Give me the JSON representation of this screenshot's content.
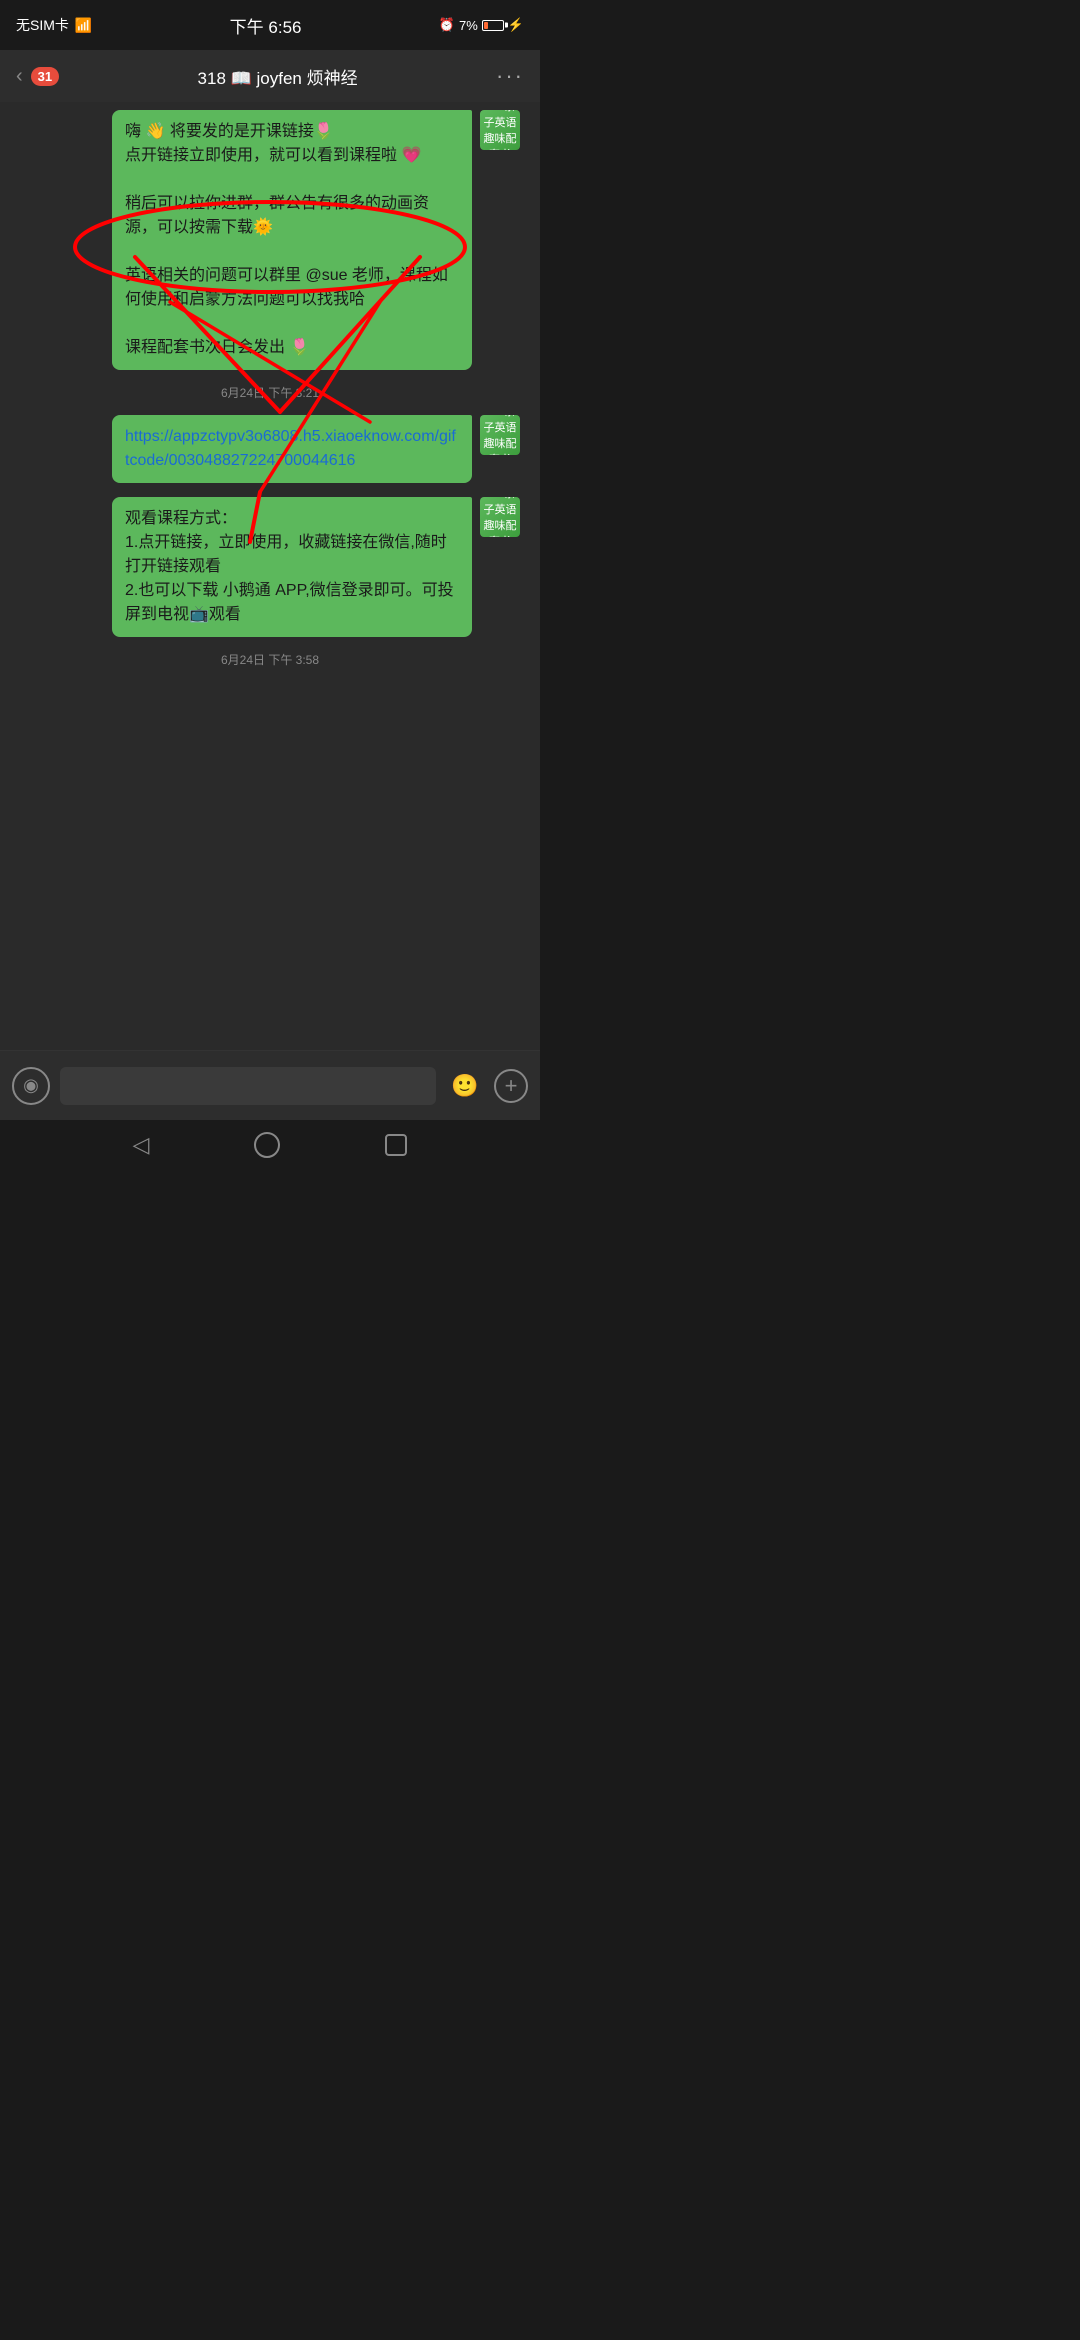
{
  "statusBar": {
    "simText": "无SIM卡",
    "wifiIcon": "wifi",
    "time": "下午 6:56",
    "alarmIcon": "alarm",
    "battery": "7%",
    "chargingIcon": "⚡"
  },
  "navBar": {
    "backLabel": "31",
    "title": "318 📖 joyfen 烦神经",
    "moreLabel": "···"
  },
  "messages": [
    {
      "id": "msg1",
      "type": "sent",
      "text": "嗨 👋 将要发的是开课链接🌷\n点开链接立即使用，就可以看到课程啦 💗\n\n稍后可以拉你进群，群公告有很多的动画资源，可以按需下载🌞\n\n英语相关的问题可以群里 @sue 老师，课程如何使用和启蒙方法问题可以找我哈\n\n课程配套书次日会发出 🌷",
      "avatarText": "Sue亲子英语\n趣味配套书"
    },
    {
      "id": "ts1",
      "type": "timestamp",
      "text": "6月24日 下午 3:21"
    },
    {
      "id": "msg2",
      "type": "sent",
      "link": "https://appzctypv3o6808.h5.xiaoeknow.com/giftcode/003048827224700044616",
      "avatarText": "Sue亲子英语\n趣味配套书"
    },
    {
      "id": "msg3",
      "type": "sent",
      "text": "观看课程方式：\n1.点开链接，立即使用，收藏链接在微信,随时打开链接观看\n2.也可以下载 小鹅通 APP,微信登录即可。可投屏到电视📺观看",
      "avatarText": "Sue亲子英语\n趣味配套书"
    },
    {
      "id": "ts2",
      "type": "timestamp",
      "text": "6月24日 下午 3:58"
    }
  ],
  "inputBar": {
    "placeholder": "",
    "voiceLabel": "🔊",
    "emojiLabel": "😊",
    "addLabel": "+"
  }
}
